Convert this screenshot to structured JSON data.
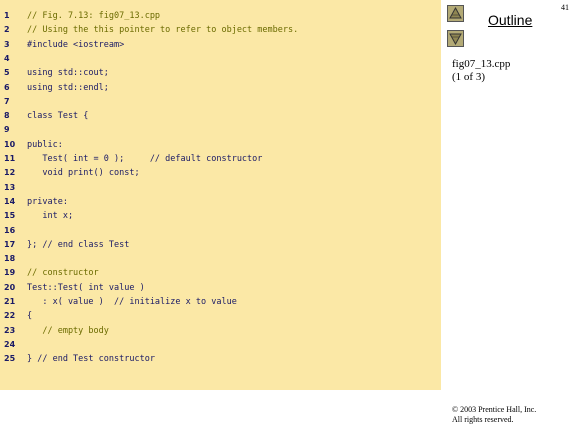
{
  "slide": {
    "page_number": "41",
    "outline_label": "Outline",
    "file_name": "fig07_13.cpp",
    "file_part": "(1 of 3)",
    "copyright_line1": "© 2003 Prentice Hall, Inc.",
    "copyright_line2": "All rights reserved."
  },
  "nav": {
    "up_icon": "triangle-up-icon",
    "down_icon": "triangle-down-icon"
  },
  "colors": {
    "code_background": "#fbe8a6",
    "code_text": "#1a1a66",
    "comment_text": "#6b6b00"
  },
  "code": {
    "lines": [
      {
        "num": "1",
        "text": "// Fig. 7.13: fig07_13.cpp",
        "comment": true
      },
      {
        "num": "2",
        "text": "// Using the this pointer to refer to object members.",
        "comment": true
      },
      {
        "num": "3",
        "text": "#include <iostream>",
        "comment": false
      },
      {
        "num": "4",
        "text": "",
        "comment": false
      },
      {
        "num": "5",
        "text": "using std::cout;",
        "comment": false
      },
      {
        "num": "6",
        "text": "using std::endl;",
        "comment": false
      },
      {
        "num": "7",
        "text": "",
        "comment": false
      },
      {
        "num": "8",
        "text": "class Test {",
        "comment": false
      },
      {
        "num": "9",
        "text": "",
        "comment": false
      },
      {
        "num": "10",
        "text": "public:",
        "comment": false
      },
      {
        "num": "11",
        "text": "   Test( int = 0 );     // default constructor",
        "comment": false
      },
      {
        "num": "12",
        "text": "   void print() const;",
        "comment": false
      },
      {
        "num": "13",
        "text": "",
        "comment": false
      },
      {
        "num": "14",
        "text": "private:",
        "comment": false
      },
      {
        "num": "15",
        "text": "   int x;",
        "comment": false
      },
      {
        "num": "16",
        "text": "",
        "comment": false
      },
      {
        "num": "17",
        "text": "}; // end class Test",
        "comment": false
      },
      {
        "num": "18",
        "text": "",
        "comment": false
      },
      {
        "num": "19",
        "text": "// constructor",
        "comment": true
      },
      {
        "num": "20",
        "text": "Test::Test( int value )",
        "comment": false
      },
      {
        "num": "21",
        "text": "   : x( value )  // initialize x to value",
        "comment": false
      },
      {
        "num": "22",
        "text": "{",
        "comment": false
      },
      {
        "num": "23",
        "text": "   // empty body",
        "comment": true
      },
      {
        "num": "24",
        "text": "",
        "comment": false
      },
      {
        "num": "25",
        "text": "} // end Test constructor",
        "comment": false
      }
    ]
  }
}
